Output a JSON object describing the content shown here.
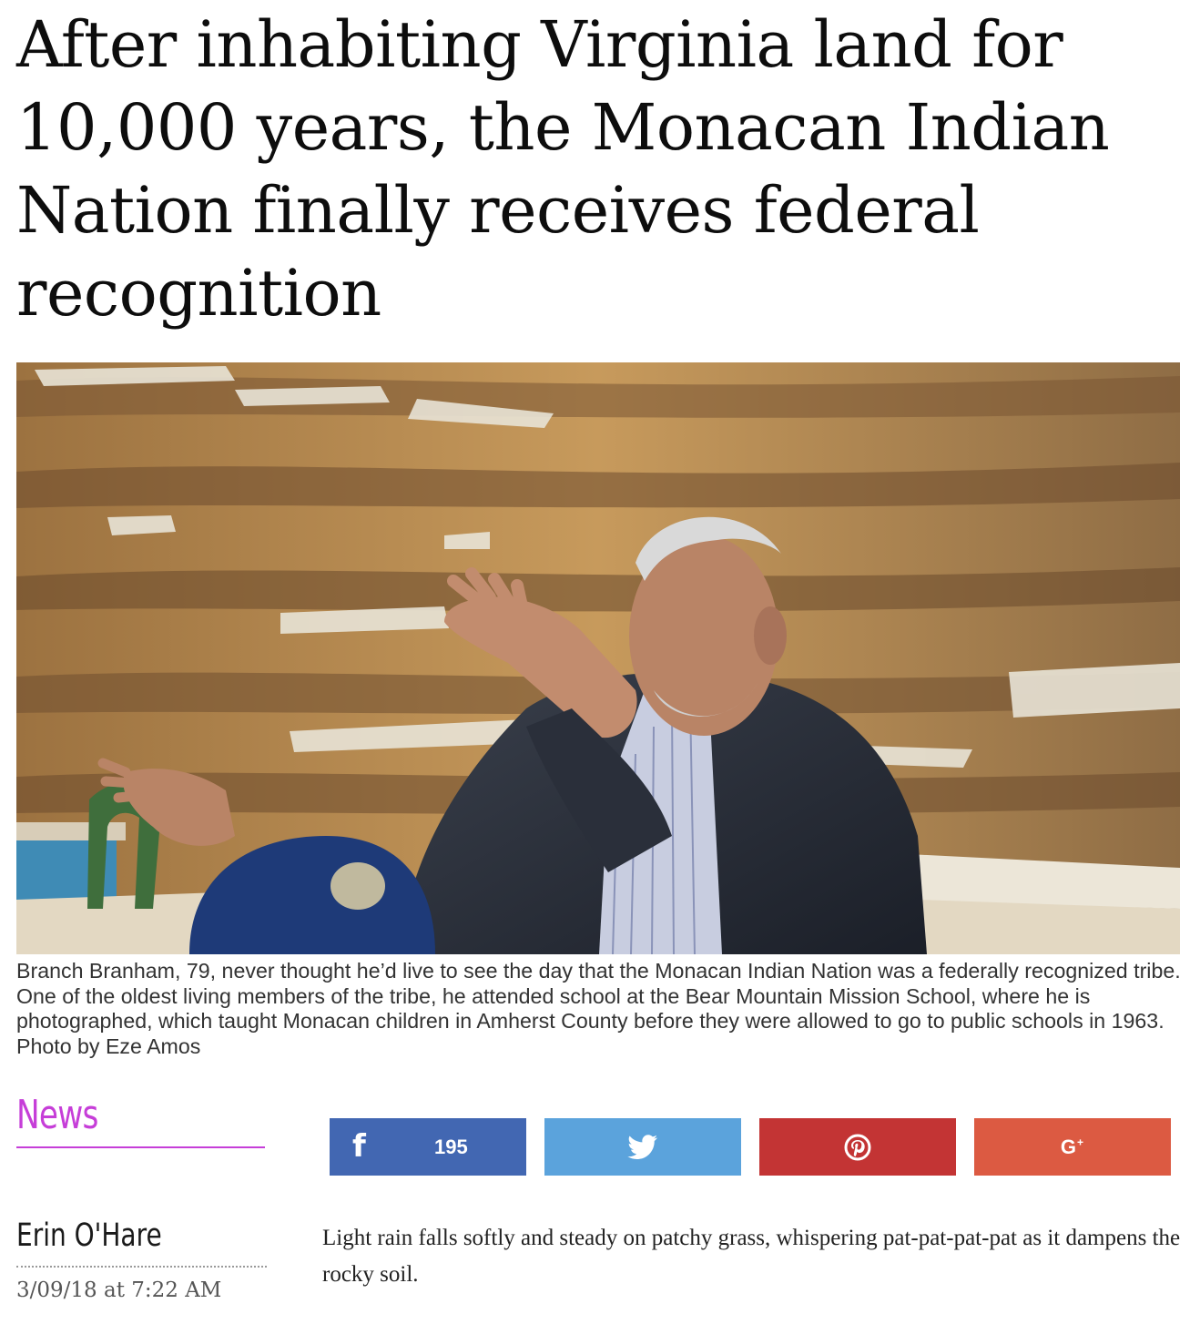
{
  "article": {
    "headline": "After inhabiting Virginia land for 10,000 years, the Monacan Indian Nation finally receives federal recognition",
    "caption": "Branch Branham, 79, never thought he’d live to see the day that the Monacan Indian Nation was a federally recognized tribe. One of the oldest living members of the tribe, he attended school at the Bear Mountain Mission School, where he is photographed, which taught Monacan children in Amherst County before they were allowed to go to public schools in 1963. Photo by Eze Amos",
    "section": "News",
    "author": "Erin O'Hare",
    "date": "3/09/18 at 7:22 AM",
    "lede": "Light rain falls softly and steady on patchy grass, whispering pat-pat-pat-pat as it dampens the rocky soil."
  },
  "share": {
    "facebook_count": "195",
    "buttons": [
      {
        "network": "facebook",
        "icon": "facebook-icon",
        "color": "#4267b2"
      },
      {
        "network": "twitter",
        "icon": "twitter-bird-icon",
        "color": "#5ba3dc"
      },
      {
        "network": "pinterest",
        "icon": "pinterest-icon",
        "color": "#c33434"
      },
      {
        "network": "google-plus",
        "icon": "google-plus-icon",
        "color": "#dc5a42"
      }
    ]
  },
  "colors": {
    "section_accent": "#c63ed8"
  }
}
